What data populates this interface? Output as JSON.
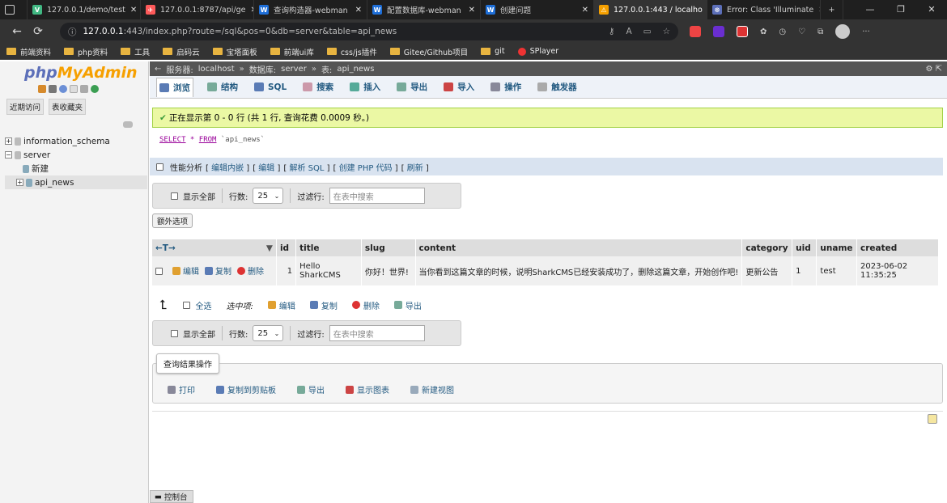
{
  "tabs": [
    {
      "label": "127.0.0.1/demo/test",
      "color": "#41b883",
      "glyph": "V"
    },
    {
      "label": "127.0.0.1:8787/api/ge",
      "color": "#ff5a5a",
      "glyph": "✈"
    },
    {
      "label": "查询构造器-webman",
      "color": "#1e6fd9",
      "glyph": "W"
    },
    {
      "label": "配置数据库-webman",
      "color": "#1e6fd9",
      "glyph": "W"
    },
    {
      "label": "创建问题",
      "color": "#1e6fd9",
      "glyph": "W"
    },
    {
      "label": "127.0.0.1:443 / localho",
      "color": "#f6a000",
      "glyph": "⚠"
    },
    {
      "label": "Error: Class 'Illuminate",
      "color": "#5c6fb9",
      "glyph": "☸"
    }
  ],
  "url": {
    "host": "127.0.0.1",
    "rest": ":443/index.php?route=/sql&pos=0&db=server&table=api_news"
  },
  "bookmarks": [
    "前端资料",
    "php资料",
    "工具",
    "启码云",
    "宝塔面板",
    "前端ui库",
    "css/js插件",
    "Gitee/Github项目",
    "git",
    "SPlayer"
  ],
  "sidebar": {
    "logo_a": "php",
    "logo_b": "MyAdmin",
    "tab_recent": "近期访问",
    "tab_fav": "表收藏夹",
    "tree": {
      "db1": "information_schema",
      "db2": "server",
      "new": "新建",
      "table": "api_news"
    }
  },
  "breadcrumb": {
    "server_label": "服务器:",
    "server": "localhost",
    "db_label": "数据库:",
    "db": "server",
    "table_label": "表:",
    "table": "api_news"
  },
  "main_tabs": [
    "浏览",
    "结构",
    "SQL",
    "搜索",
    "插入",
    "导出",
    "导入",
    "操作",
    "触发器"
  ],
  "success": "正在显示第 0 - 0 行 (共 1 行, 查询花费 0.0009 秒。)",
  "sql": {
    "kw": "SELECT",
    "star": " * ",
    "from": "FROM",
    "tbl": " `api_news`"
  },
  "profiling": {
    "label": "性能分析",
    "links": [
      "编辑内嵌",
      "编辑",
      "解析 SQL",
      "创建 PHP 代码",
      "刷新"
    ]
  },
  "nav": {
    "show_all": "显示全部",
    "rows": "行数:",
    "rows_val": "25",
    "filter": "过滤行:",
    "filter_ph": "在表中搜索"
  },
  "extra": "额外选项",
  "columns": [
    "id",
    "title",
    "slug",
    "content",
    "category",
    "uid",
    "uname",
    "created"
  ],
  "row": {
    "edit": "编辑",
    "copy": "复制",
    "delete": "删除",
    "id": "1",
    "title": "Hello SharkCMS",
    "slug": "你好！世界!",
    "content": "当你看到这篇文章的时候，说明SharkCMS已经安装成功了，删除这篇文章，开始创作吧!",
    "category": "更新公告",
    "uid": "1",
    "uname": "test",
    "created": "2023-06-02 11:35:25"
  },
  "bulk": {
    "check_all": "全选",
    "selected": "选中项:",
    "edit": "编辑",
    "copy": "复制",
    "delete": "删除",
    "export": "导出"
  },
  "query_ops": {
    "legend": "查询结果操作",
    "print": "打印",
    "clip": "复制到剪贴板",
    "export": "导出",
    "chart": "显示图表",
    "view": "新建视图"
  },
  "console": "控制台"
}
